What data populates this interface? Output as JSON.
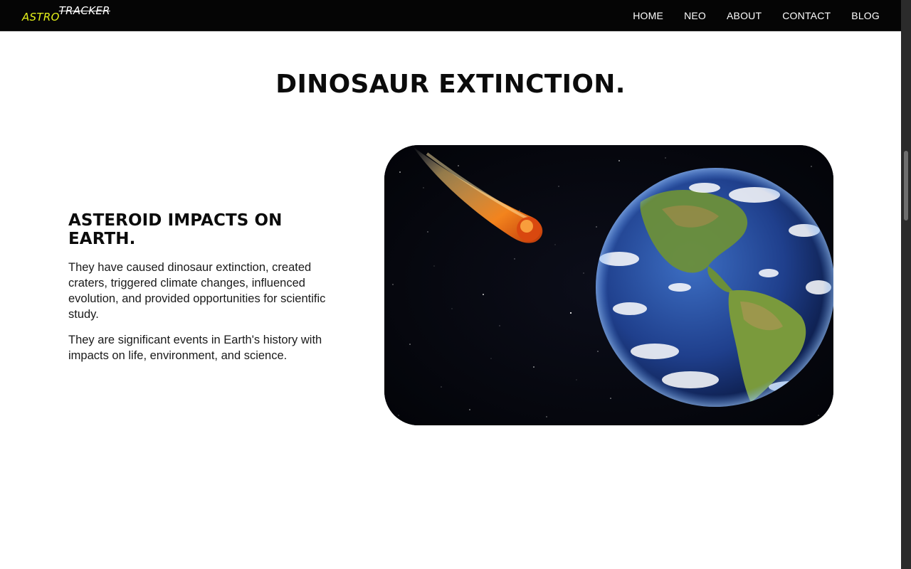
{
  "brand": {
    "part1": "ASTRO",
    "part2": "TRACKER",
    "accent_color": "#e6f21a"
  },
  "nav": {
    "items": [
      {
        "label": "HOME"
      },
      {
        "label": "NEO"
      },
      {
        "label": "ABOUT"
      },
      {
        "label": "CONTACT"
      },
      {
        "label": "BLOG"
      }
    ]
  },
  "main": {
    "title": "DINOSAUR EXTINCTION.",
    "section": {
      "heading": "ASTEROID IMPACTS ON EARTH.",
      "paragraphs": [
        "They have caused dinosaur extinction, created craters, triggered climate changes, influenced evolution, and provided opportunities for scientific study.",
        "They are significant events in Earth's history with impacts on life, environment, and science."
      ]
    },
    "image": {
      "subject": "asteroid-approaching-earth-illustration"
    }
  }
}
